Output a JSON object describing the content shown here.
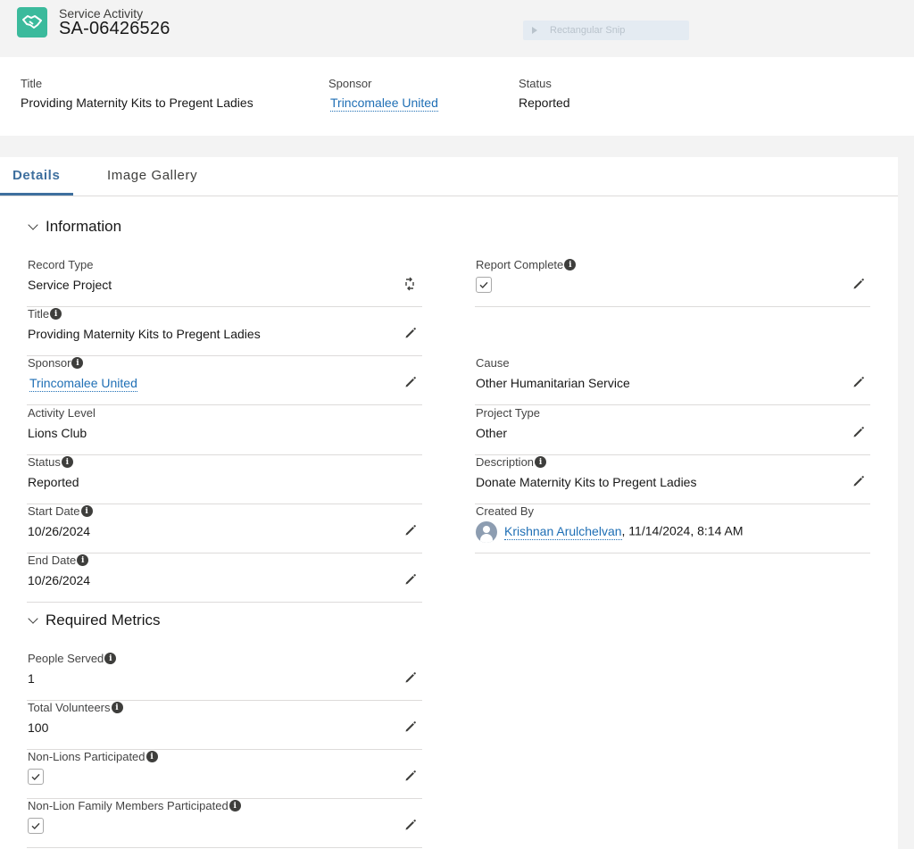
{
  "header": {
    "object_label": "Service Activity",
    "record_name": "SA-06426526",
    "icon": "handshake-icon",
    "snip_label": "Rectangular Snip"
  },
  "highlights": {
    "title_label": "Title",
    "title_value": "Providing Maternity Kits to Pregent Ladies",
    "sponsor_label": "Sponsor",
    "sponsor_value": "Trincomalee United",
    "status_label": "Status",
    "status_value": "Reported"
  },
  "tabs": [
    {
      "label": "Details",
      "active": true
    },
    {
      "label": "Image Gallery",
      "active": false
    }
  ],
  "sections": {
    "information": "Information",
    "required_metrics": "Required Metrics"
  },
  "information_left": [
    {
      "label": "Record Type",
      "value": "Service Project"
    },
    {
      "label": "Title",
      "value": "Providing Maternity Kits to Pregent Ladies"
    },
    {
      "label": "Sponsor",
      "value": "Trincomalee United"
    },
    {
      "label": "Activity Level",
      "value": "Lions Club"
    },
    {
      "label": "Status",
      "value": "Reported"
    },
    {
      "label": "Start Date",
      "value": "10/26/2024"
    },
    {
      "label": "End Date",
      "value": "10/26/2024"
    }
  ],
  "information_right": [
    {
      "label": "Report Complete",
      "checked": true
    },
    {
      "label": "Cause",
      "value": "Other Humanitarian Service"
    },
    {
      "label": "Project Type",
      "value": "Other"
    },
    {
      "label": "Description",
      "value": "Donate Maternity Kits to Pregent Ladies"
    },
    {
      "label": "Created By",
      "user": "Krishnan Arulchelvan",
      "timestamp": ", 11/14/2024, 8:14 AM"
    }
  ],
  "required_metrics": [
    {
      "label": "People Served",
      "value": "1"
    },
    {
      "label": "Total Volunteers",
      "value": "100"
    },
    {
      "label": "Non-Lions Participated",
      "checked": true
    },
    {
      "label": "Non-Lion Family Members Participated",
      "checked": true
    }
  ],
  "colors": {
    "accent": "#3e6f9e",
    "link": "#1f6fb5",
    "icon_bg": "#3bba9c",
    "page_bg": "#f3f3f3"
  }
}
